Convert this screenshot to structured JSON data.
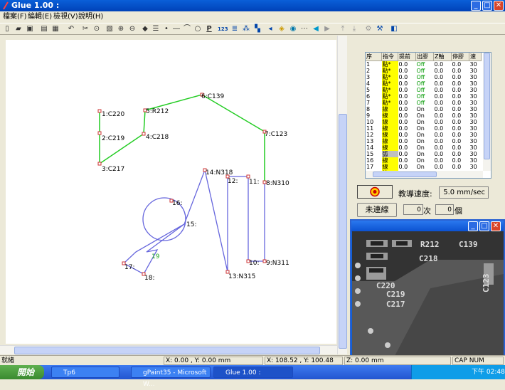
{
  "window": {
    "title": "Glue 1.00 :"
  },
  "menu": [
    "檔案(F)",
    "編輯(E)",
    "檢視(V)",
    "說明(H)"
  ],
  "toolbar_icons": [
    "new-file-icon",
    "open-folder-icon",
    "save-icon",
    "open-icon",
    "print-icon",
    "cut-icon",
    "undo-icon",
    "tool-a-icon",
    "tool-b-icon",
    "zoom-in-icon",
    "zoom-out-icon",
    "zoom-fit-icon",
    "list-icon",
    "point-icon",
    "line-icon",
    "arc-icon",
    "circle-icon",
    "p-icon",
    "123-icon",
    "stack-icon",
    "stack-b-icon",
    "multi-icon",
    "grid-icon",
    "move-icon",
    "diamond-icon",
    "ring-icon",
    "dash-icon",
    "left-icon",
    "right-icon",
    "up-icon",
    "down-icon",
    "robot-icon",
    "robot-b-icon",
    "help-icon"
  ],
  "toolbar_labels": {
    "p": "P",
    "n123": "123"
  },
  "canvas": {
    "points": [
      {
        "label": "1:C220"
      },
      {
        "label": "2:C219"
      },
      {
        "label": "3:C217"
      },
      {
        "label": "4:C218"
      },
      {
        "label": "5:R212"
      },
      {
        "label": "6:C139"
      },
      {
        "label": "7:C123"
      },
      {
        "label": "8:N310"
      },
      {
        "label": "9:N311"
      },
      {
        "label": "10:"
      },
      {
        "label": "11:"
      },
      {
        "label": "12:"
      },
      {
        "label": "13:N315"
      },
      {
        "label": "14:N318"
      },
      {
        "label": "15:"
      },
      {
        "label": "16:"
      },
      {
        "label": "17:"
      },
      {
        "label": "18:"
      },
      {
        "label": "19"
      }
    ]
  },
  "table": {
    "headers": [
      "序",
      "指令",
      "提前",
      "出膠",
      "Z軸",
      "停膠",
      "速"
    ],
    "rows": [
      [
        "1",
        "點*",
        "0.0",
        "Off",
        "0.0",
        "0.0",
        "30"
      ],
      [
        "2",
        "點*",
        "0.0",
        "Off",
        "0.0",
        "0.0",
        "30"
      ],
      [
        "3",
        "點*",
        "0.0",
        "Off",
        "0.0",
        "0.0",
        "30"
      ],
      [
        "4",
        "點*",
        "0.0",
        "Off",
        "0.0",
        "0.0",
        "30"
      ],
      [
        "5",
        "點*",
        "0.0",
        "Off",
        "0.0",
        "0.0",
        "30"
      ],
      [
        "6",
        "點*",
        "0.0",
        "Off",
        "0.0",
        "0.0",
        "30"
      ],
      [
        "7",
        "點*",
        "0.0",
        "Off",
        "0.0",
        "0.0",
        "30"
      ],
      [
        "8",
        "線",
        "0.0",
        "On",
        "0.0",
        "0.0",
        "30"
      ],
      [
        "9",
        "線",
        "0.0",
        "On",
        "0.0",
        "0.0",
        "30"
      ],
      [
        "10",
        "線",
        "0.0",
        "On",
        "0.0",
        "0.0",
        "30"
      ],
      [
        "11",
        "線",
        "0.0",
        "On",
        "0.0",
        "0.0",
        "30"
      ],
      [
        "12",
        "線",
        "0.0",
        "On",
        "0.0",
        "0.0",
        "30"
      ],
      [
        "13",
        "線",
        "0.0",
        "On",
        "0.0",
        "0.0",
        "30"
      ],
      [
        "14",
        "線",
        "0.0",
        "On",
        "0.0",
        "0.0",
        "30"
      ],
      [
        "15",
        "弧",
        "0.0",
        "On",
        "0.0",
        "0.0",
        "30"
      ],
      [
        "16",
        "線",
        "0.0",
        "On",
        "0.0",
        "0.0",
        "30"
      ],
      [
        "17",
        "線",
        "0.0",
        "On",
        "0.0",
        "0.0",
        "30"
      ],
      [
        "18",
        "線",
        "0.0",
        "On",
        "0.0",
        "0.0",
        "30"
      ]
    ]
  },
  "controls": {
    "speed_label": "教導速度:",
    "speed_value": "5.0 mm/sec",
    "continuous_label": "未連線",
    "count_value": "0",
    "count_unit": "次",
    "piece_value": "0",
    "piece_unit": "個"
  },
  "camera": {
    "labels": [
      "R212",
      "C139",
      "C218",
      "C220",
      "C219",
      "C217",
      "C123"
    ]
  },
  "status": {
    "ready": "就緒",
    "cursor": "X: 0.00 , Y: 0.00 mm",
    "position": "X: 108.52 , Y: 100.48 mm",
    "z": "Z: 0.00 mm",
    "caps": "CAP NUM"
  },
  "taskbar": {
    "start": "開始",
    "tasks": [
      "Tp6",
      "gPaint35 - Microsoft W...",
      "Glue 1.00 :"
    ],
    "clock": "下午 02:48"
  },
  "colors": {
    "path_green": "#22cc22",
    "path_blue": "#6666dd",
    "point_red": "#cc3333",
    "highlight_yellow": "#ffff00"
  }
}
